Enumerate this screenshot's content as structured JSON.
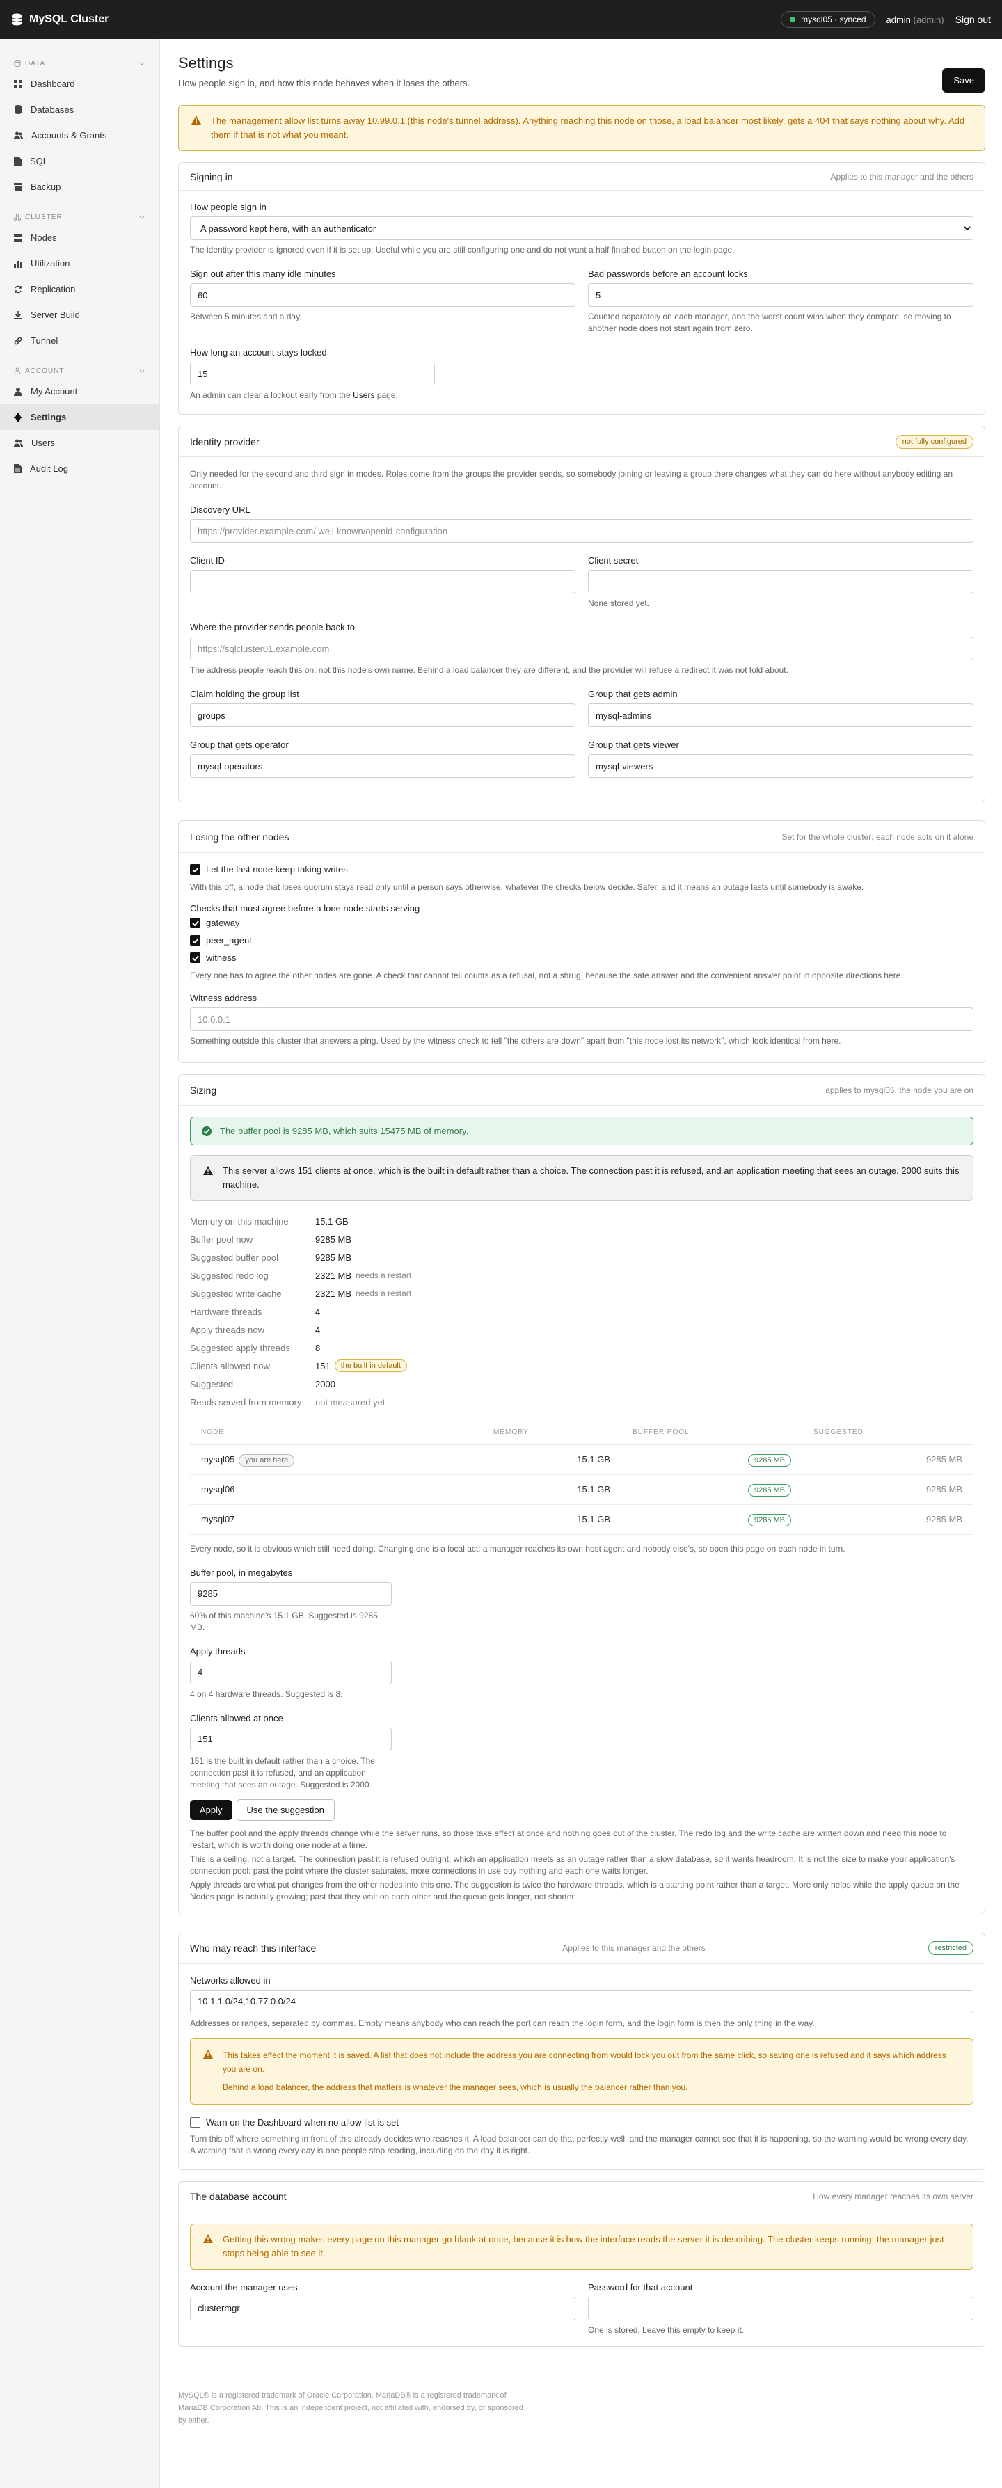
{
  "app": {
    "title": "MySQL Cluster"
  },
  "topbar": {
    "sync": "mysql05 · synced",
    "user": "admin",
    "role": "(admin)",
    "signout": "Sign out"
  },
  "sidebar": {
    "sections": [
      {
        "label": "DATA",
        "items": [
          "Dashboard",
          "Databases",
          "Accounts & Grants",
          "SQL",
          "Backup"
        ]
      },
      {
        "label": "CLUSTER",
        "items": [
          "Nodes",
          "Utilization",
          "Replication",
          "Server Build",
          "Tunnel"
        ]
      },
      {
        "label": "ACCOUNT",
        "items": [
          "My Account",
          "Settings",
          "Users",
          "Audit Log"
        ]
      }
    ],
    "active": "Settings"
  },
  "page": {
    "title": "Settings",
    "subtitle": "How people sign in, and how this node behaves when it loses the others.",
    "save": "Save",
    "warning": "The management allow list turns away 10.99.0.1 (this node's tunnel address). Anything reaching this node on those, a load balancer most likely, gets a 404 that says nothing about why. Add them if that is not what you meant."
  },
  "signin": {
    "title": "Signing in",
    "hint": "Applies to this manager and the others",
    "method_label": "How people sign in",
    "method_value": "A password kept here, with an authenticator",
    "method_help": "The identity provider is ignored even if it is set up. Useful while you are still configuring one and do not want a half finished button on the login page.",
    "idle_label": "Sign out after this many idle minutes",
    "idle_value": "60",
    "idle_help": "Between 5 minutes and a day.",
    "bad_label": "Bad passwords before an account locks",
    "bad_value": "5",
    "bad_help": "Counted separately on each manager, and the worst count wins when they compare, so moving to another node does not start again from zero.",
    "lock_label": "How long an account stays locked",
    "lock_value": "15",
    "lock_help_pre": "An admin can clear a lockout early from the ",
    "lock_help_link": "Users",
    "lock_help_post": " page."
  },
  "idp": {
    "title": "Identity provider",
    "badge": "not fully configured",
    "intro": "Only needed for the second and third sign in modes. Roles come from the groups the provider sends, so somebody joining or leaving a group there changes what they can do here without anybody editing an account.",
    "discovery_label": "Discovery URL",
    "discovery_placeholder": "https://provider.example.com/.well-known/openid-configuration",
    "client_id_label": "Client ID",
    "client_secret_label": "Client secret",
    "client_secret_help": "None stored yet.",
    "redirect_label": "Where the provider sends people back to",
    "redirect_placeholder": "https://sqlcluster01.example.com",
    "redirect_help": "The address people reach this on, not this node's own name. Behind a load balancer they are different, and the provider will refuse a redirect it was not told about.",
    "claim_label": "Claim holding the group list",
    "claim_value": "groups",
    "admin_label": "Group that gets admin",
    "admin_value": "mysql-admins",
    "operator_label": "Group that gets operator",
    "operator_value": "mysql-operators",
    "viewer_label": "Group that gets viewer",
    "viewer_value": "mysql-viewers"
  },
  "losing": {
    "title": "Losing the other nodes",
    "hint": "Set for the whole cluster; each node acts on it alone",
    "keep_label": "Let the last node keep taking writes",
    "keep_help": "With this off, a node that loses quorum stays read only until a person says otherwise, whatever the checks below decide. Safer, and it means an outage lasts until somebody is awake.",
    "checks_label": "Checks that must agree before a lone node starts serving",
    "checks": [
      "gateway",
      "peer_agent",
      "witness"
    ],
    "checks_help": "Every one has to agree the other nodes are gone. A check that cannot tell counts as a refusal, not a shrug, because the safe answer and the convenient answer point in opposite directions here.",
    "witness_label": "Witness address",
    "witness_placeholder": "10.0.0.1",
    "witness_help": "Something outside this cluster that answers a ping. Used by the witness check to tell \"the others are down\" apart from \"this node lost its network\", which look identical from here."
  },
  "sizing": {
    "title": "Sizing",
    "hint": "applies to mysql05, the node you are on",
    "ok": "The buffer pool is 9285 MB, which suits 15475 MB of memory.",
    "info": "This server allows 151 clients at once, which is the built in default rather than a choice. The connection past it is refused, and an application meeting that sees an outage. 2000 suits this machine.",
    "facts": [
      {
        "k": "Memory on this machine",
        "v": "15.1 GB",
        "note": ""
      },
      {
        "k": "Buffer pool now",
        "v": "9285 MB",
        "note": ""
      },
      {
        "k": "Suggested buffer pool",
        "v": "9285 MB",
        "note": ""
      },
      {
        "k": "Suggested redo log",
        "v": "2321 MB",
        "note": "needs a restart"
      },
      {
        "k": "Suggested write cache",
        "v": "2321 MB",
        "note": "needs a restart"
      },
      {
        "k": "Hardware threads",
        "v": "4",
        "note": ""
      },
      {
        "k": "Apply threads now",
        "v": "4",
        "note": ""
      },
      {
        "k": "Suggested apply threads",
        "v": "8",
        "note": ""
      },
      {
        "k": "Clients allowed now",
        "v": "151",
        "note": ""
      },
      {
        "k": "Suggested",
        "v": "2000",
        "note": ""
      },
      {
        "k": "Reads served from memory",
        "v": "not measured yet",
        "note": ""
      }
    ],
    "clients_badge": "the built in default",
    "table_headers": [
      "NODE",
      "MEMORY",
      "BUFFER POOL",
      "SUGGESTED"
    ],
    "nodes": [
      {
        "name": "mysql05",
        "here": "you are here",
        "memory": "15.1 GB",
        "pool": "9285 MB",
        "suggested": "9285 MB"
      },
      {
        "name": "mysql06",
        "here": "",
        "memory": "15.1 GB",
        "pool": "9285 MB",
        "suggested": "9285 MB"
      },
      {
        "name": "mysql07",
        "here": "",
        "memory": "15.1 GB",
        "pool": "9285 MB",
        "suggested": "9285 MB"
      }
    ],
    "table_help": "Every node, so it is obvious which still need doing. Changing one is a local act: a manager reaches its own host agent and nobody else's, so open this page on each node in turn.",
    "pool_label": "Buffer pool, in megabytes",
    "pool_value": "9285",
    "pool_help": "60% of this machine's 15.1 GB. Suggested is 9285 MB.",
    "apply_label": "Apply threads",
    "apply_value": "4",
    "apply_help": "4 on 4 hardware threads. Suggested is 8.",
    "clients_label": "Clients allowed at once",
    "clients_value": "151",
    "clients_help": "151 is the built in default rather than a choice. The connection past it is refused, and an application meeting that sees an outage. Suggested is 2000.",
    "apply_btn": "Apply",
    "suggest_btn": "Use the suggestion",
    "notes": [
      "The buffer pool and the apply threads change while the server runs, so those take effect at once and nothing goes out of the cluster. The redo log and the write cache are written down and need this node to restart, which is worth doing one node at a time.",
      "This is a ceiling, not a target. The connection past it is refused outright, which an application meets as an outage rather than a slow database, so it wants headroom. It is not the size to make your application's connection pool: past the point where the cluster saturates, more connections in use buy nothing and each one waits longer.",
      "Apply threads are what put changes from the other nodes into this one. The suggestion is twice the hardware threads, which is a starting point rather than a target. More only helps while the apply queue on the Nodes page is actually growing; past that they wait on each other and the queue gets longer, not shorter."
    ]
  },
  "reach": {
    "title": "Who may reach this interface",
    "hint": "Applies to this manager and the others",
    "badge": "restricted",
    "networks_label": "Networks allowed in",
    "networks_value": "10.1.1.0/24,10.77.0.0/24",
    "networks_help": "Addresses or ranges, separated by commas. Empty means anybody who can reach the port can reach the login form, and the login form is then the only thing in the way.",
    "warn1": "This takes effect the moment it is saved. A list that does not include the address you are connecting from would lock you out from the same click, so saving one is refused and it says which address you are on.",
    "warn2": "Behind a load balancer, the address that matters is whatever the manager sees, which is usually the balancer rather than you.",
    "dash_label": "Warn on the Dashboard when no allow list is set",
    "dash_help": "Turn this off where something in front of this already decides who reaches it. A load balancer can do that perfectly well, and the manager cannot see that it is happening, so the warning would be wrong every day. A warning that is wrong every day is one people stop reading, including on the day it is right."
  },
  "account": {
    "title": "The database account",
    "hint": "How every manager reaches its own server",
    "warn": "Getting this wrong makes every page on this manager go blank at once, because it is how the interface reads the server it is describing. The cluster keeps running; the manager just stops being able to see it.",
    "user_label": "Account the manager uses",
    "user_value": "clustermgr",
    "pass_label": "Password for that account",
    "pass_help": "One is stored. Leave this empty to keep it."
  },
  "footer": "MySQL® is a registered trademark of Oracle Corporation. MariaDB® is a registered trademark of MariaDB Corporation Ab. This is an independent project, not affiliated with, endorsed by, or sponsored by either."
}
